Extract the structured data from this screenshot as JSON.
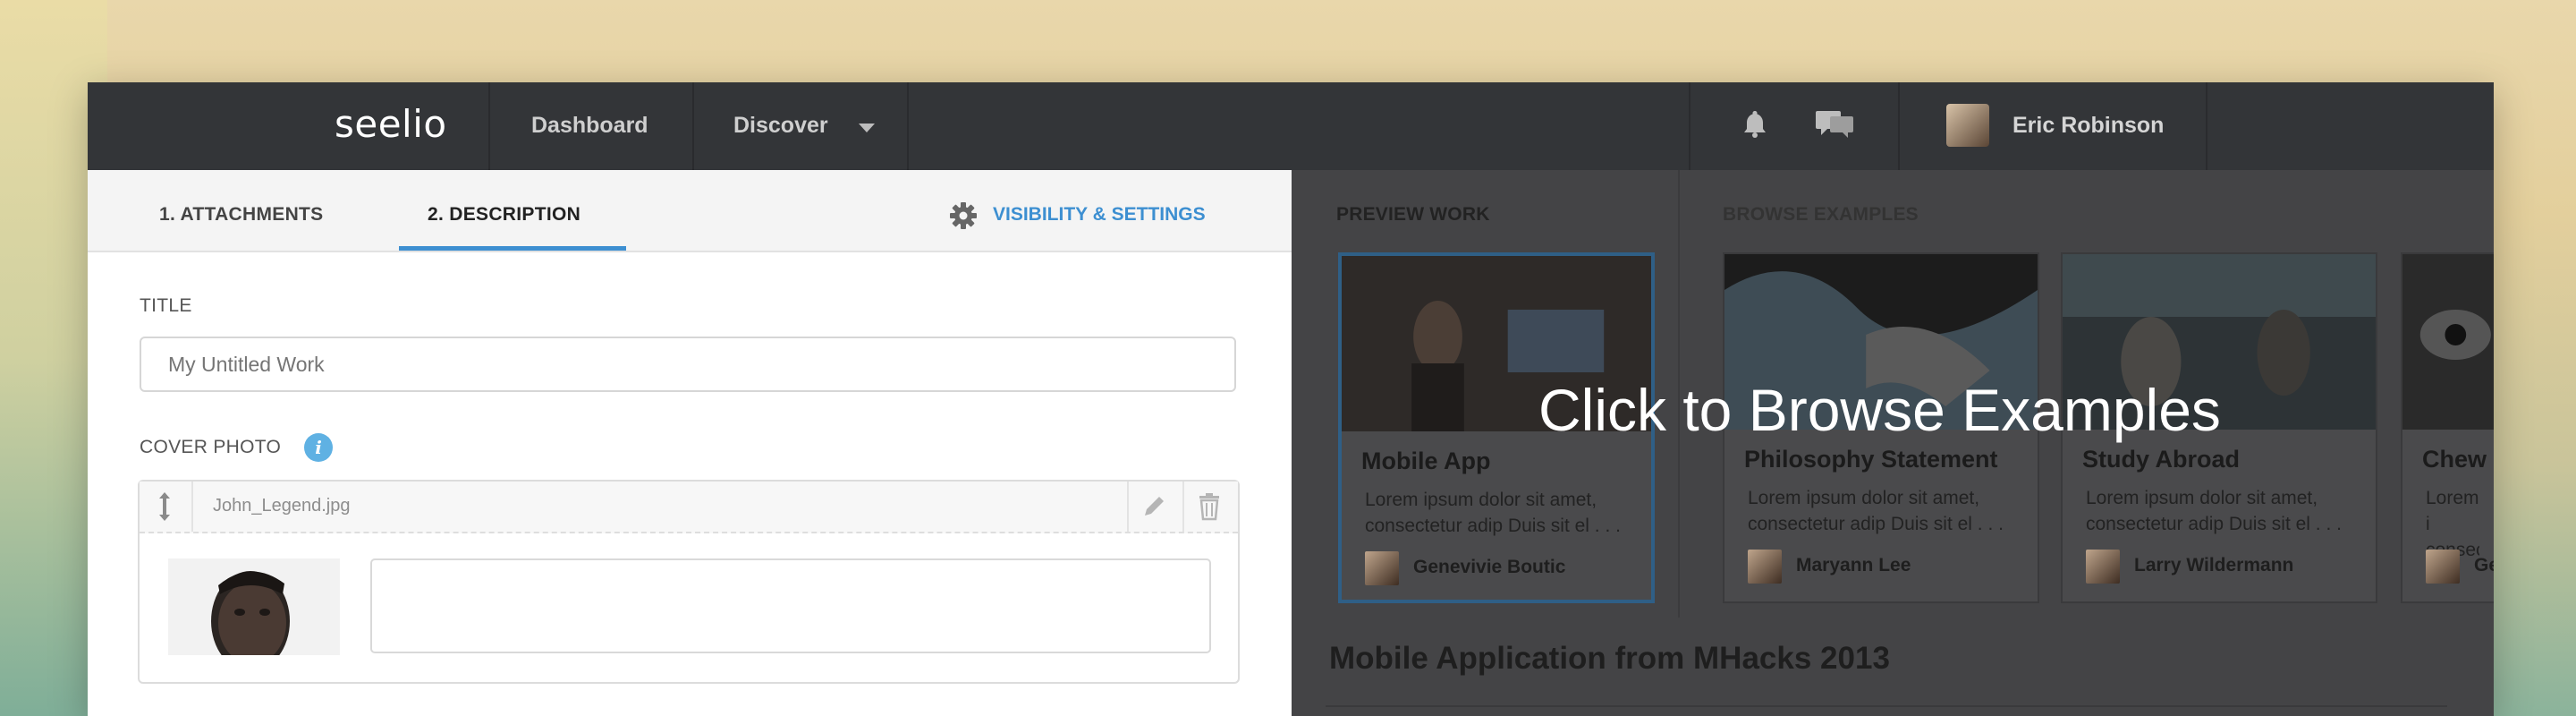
{
  "nav": {
    "logo": "seelio",
    "links": [
      {
        "label": "Dashboard"
      },
      {
        "label": "Discover"
      }
    ],
    "user": {
      "name": "Eric Robinson"
    },
    "icons": [
      "bell-icon",
      "chat-icon"
    ]
  },
  "editor": {
    "tabs": [
      {
        "label": "1.  ATTACHMENTS"
      },
      {
        "label": "2.  DESCRIPTION"
      }
    ],
    "settings_label": "VISIBILITY & SETTINGS",
    "title_label": "TITLE",
    "title_placeholder": "My Untitled Work",
    "cover_label": "COVER PHOTO",
    "info_glyph": "i",
    "cover_filename": "John_Legend.jpg"
  },
  "preview": {
    "preview_label": "PREVIEW WORK",
    "browse_label": "BROWSE EXAMPLES",
    "overlay": "Click to Browse Examples",
    "project_title": "Mobile Application from MHacks 2013",
    "cards": [
      {
        "title": "Mobile App",
        "desc": "Lorem ipsum dolor sit amet, consectetur adip Duis sit el . . .",
        "author": "Genevivie Boutic"
      },
      {
        "title": "Philosophy Statement",
        "desc": "Lorem ipsum dolor sit amet, consectetur adip Duis sit el . . .",
        "author": "Maryann Lee"
      },
      {
        "title": "Study Abroad",
        "desc": "Lorem ipsum dolor sit amet, consectetur adip Duis sit el . . .",
        "author": "Larry Wildermann"
      },
      {
        "title": "Chew",
        "desc": "Lorem i consect",
        "author": "Ge"
      }
    ]
  },
  "colors": {
    "accent": "#3d8fd1",
    "nav_bg": "#333538",
    "info": "#5fb1e3"
  }
}
